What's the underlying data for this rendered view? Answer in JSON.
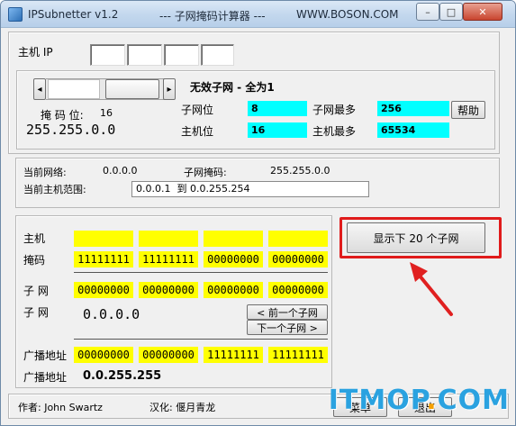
{
  "window": {
    "app_title": "IPSubnetter v1.2",
    "subtitle": "--- 子网掩码计算器 ---",
    "site": "WWW.BOSON.COM",
    "minimize": "–",
    "maximize": "□",
    "close": "✕"
  },
  "ip": {
    "label": "主机 IP",
    "octets": [
      "",
      "",
      "",
      ""
    ]
  },
  "mask": {
    "invalid_subnet": "无效子网 - 全为1",
    "mask_bits_label": "掩 码 位:",
    "mask_bits_value": "16",
    "mask_value": "255.255.0.0",
    "subnet_bits_label": "子网位",
    "subnet_bits_value": "8",
    "max_subnets_label": "子网最多",
    "max_subnets_value": "256",
    "host_bits_label": "主机位",
    "host_bits_value": "16",
    "max_hosts_label": "主机最多",
    "max_hosts_value": "65534",
    "help_button": "帮助",
    "left_arrow": "◂",
    "right_arrow": "▸"
  },
  "network": {
    "current_network_label": "当前网络:",
    "current_network_value": "0.0.0.0",
    "subnet_mask_label": "子网掩码:",
    "subnet_mask_value": "255.255.0.0",
    "host_range_label": "当前主机范围:",
    "host_range_value": "0.0.0.1  到 0.0.255.254"
  },
  "binary": {
    "host_label": "主机",
    "host_bits": [
      "",
      "",
      "",
      ""
    ],
    "mask_label": "掩码",
    "mask_bits": [
      "11111111",
      "11111111",
      "00000000",
      "00000000"
    ],
    "subnet_label": "子 网",
    "subnet_bits": [
      "00000000",
      "00000000",
      "00000000",
      "00000000"
    ],
    "subnet_label2": "子 网",
    "subnet_value": "0.0.0.0",
    "prev_button": "< 前一个子网",
    "next_button": "下一个子网 >",
    "broadcast_label": "广播地址",
    "broadcast_bits": [
      "00000000",
      "00000000",
      "11111111",
      "11111111"
    ],
    "broadcast_label2": "广播地址",
    "broadcast_value": "0.0.255.255"
  },
  "show_next_button": "显示下 20 个子网",
  "footer": {
    "author": "作者: John Swartz",
    "localized": "汉化: 偃月青龙",
    "menu_button": "菜单",
    "exit_button": "退出"
  },
  "watermark": {
    "part1": "ITMOP",
    "dot": ".",
    "part2": "COM"
  },
  "colors": {
    "highlight_red": "#e01b1b",
    "cyan": "#00ffff",
    "yellow": "#ffff00",
    "arrow_red": "#e02020"
  }
}
